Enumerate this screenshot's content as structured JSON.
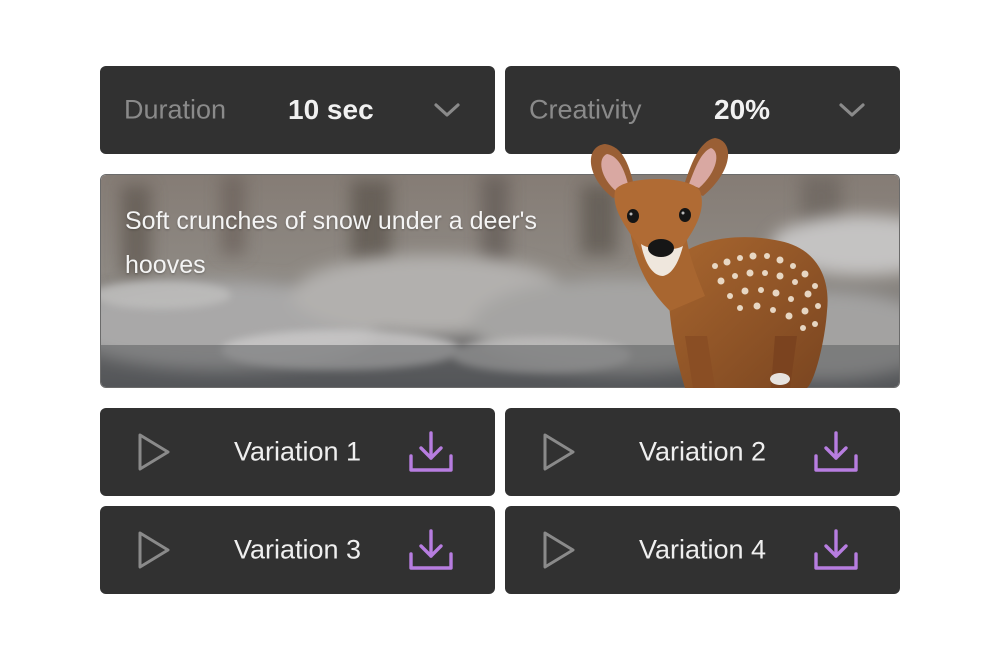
{
  "controls": {
    "duration": {
      "label": "Duration",
      "value": "10 sec"
    },
    "creativity": {
      "label": "Creativity",
      "value": "20%"
    }
  },
  "prompt": {
    "text": "Soft crunches of snow under a deer's hooves"
  },
  "variations": [
    {
      "label": "Variation 1"
    },
    {
      "label": "Variation 2"
    },
    {
      "label": "Variation 3"
    },
    {
      "label": "Variation 4"
    }
  ],
  "icons": {
    "chevron": "chevron-down-icon",
    "play": "play-icon",
    "download": "download-icon"
  },
  "colors": {
    "panel": "#313131",
    "accent": "#b77de0",
    "muted": "#8a8a8a",
    "text": "#f1f1f1"
  }
}
